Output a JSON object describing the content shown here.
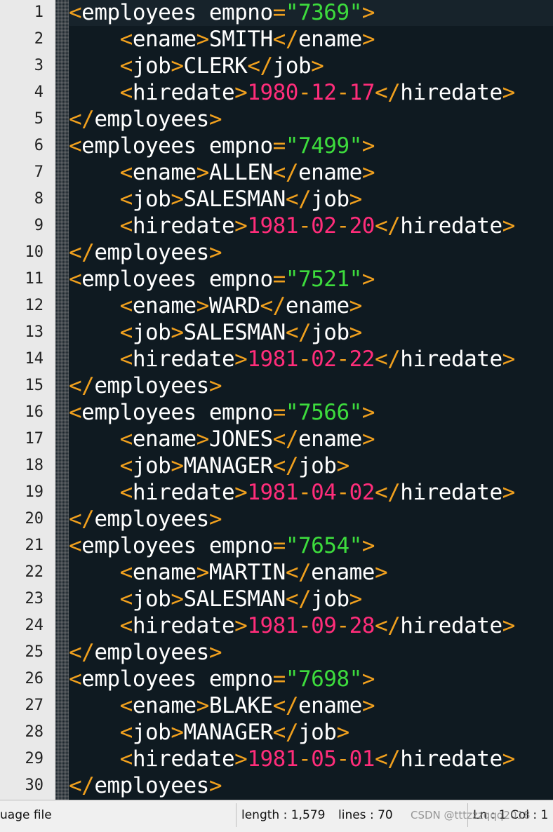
{
  "editor": {
    "current_line": 1,
    "colors": {
      "background": "#0f1a21",
      "bracket": "#f0a01e",
      "tag": "#ffffff",
      "attr_value": "#3ddc3d",
      "date": "#ff2d7a",
      "gutter": "#e9e9e9"
    },
    "lines": [
      {
        "num": "1",
        "tokens": [
          {
            "t": "<",
            "c": "bracket"
          },
          {
            "t": "employees",
            "c": "tag"
          },
          {
            "t": " empno",
            "c": "attr"
          },
          {
            "t": "=",
            "c": "eq"
          },
          {
            "t": "\"7369\"",
            "c": "str"
          },
          {
            "t": ">",
            "c": "bracket"
          }
        ]
      },
      {
        "num": "2",
        "tokens": [
          {
            "t": "    ",
            "c": "text"
          },
          {
            "t": "<",
            "c": "bracket"
          },
          {
            "t": "ename",
            "c": "tag"
          },
          {
            "t": ">",
            "c": "bracket"
          },
          {
            "t": "SMITH",
            "c": "text"
          },
          {
            "t": "</",
            "c": "bracket"
          },
          {
            "t": "ename",
            "c": "tag"
          },
          {
            "t": ">",
            "c": "bracket"
          }
        ]
      },
      {
        "num": "3",
        "tokens": [
          {
            "t": "    ",
            "c": "text"
          },
          {
            "t": "<",
            "c": "bracket"
          },
          {
            "t": "job",
            "c": "tag"
          },
          {
            "t": ">",
            "c": "bracket"
          },
          {
            "t": "CLERK",
            "c": "text"
          },
          {
            "t": "</",
            "c": "bracket"
          },
          {
            "t": "job",
            "c": "tag"
          },
          {
            "t": ">",
            "c": "bracket"
          }
        ]
      },
      {
        "num": "4",
        "tokens": [
          {
            "t": "    ",
            "c": "text"
          },
          {
            "t": "<",
            "c": "bracket"
          },
          {
            "t": "hiredate",
            "c": "tag"
          },
          {
            "t": ">",
            "c": "bracket"
          },
          {
            "t": "1980",
            "c": "num"
          },
          {
            "t": "-",
            "c": "bracket"
          },
          {
            "t": "12",
            "c": "num"
          },
          {
            "t": "-",
            "c": "bracket"
          },
          {
            "t": "17",
            "c": "num"
          },
          {
            "t": "</",
            "c": "bracket"
          },
          {
            "t": "hiredate",
            "c": "tag"
          },
          {
            "t": ">",
            "c": "bracket"
          }
        ]
      },
      {
        "num": "5",
        "tokens": [
          {
            "t": "</",
            "c": "bracket"
          },
          {
            "t": "employees",
            "c": "tag"
          },
          {
            "t": ">",
            "c": "bracket"
          }
        ]
      },
      {
        "num": "6",
        "tokens": [
          {
            "t": "<",
            "c": "bracket"
          },
          {
            "t": "employees",
            "c": "tag"
          },
          {
            "t": " empno",
            "c": "attr"
          },
          {
            "t": "=",
            "c": "eq"
          },
          {
            "t": "\"7499\"",
            "c": "str"
          },
          {
            "t": ">",
            "c": "bracket"
          }
        ]
      },
      {
        "num": "7",
        "tokens": [
          {
            "t": "    ",
            "c": "text"
          },
          {
            "t": "<",
            "c": "bracket"
          },
          {
            "t": "ename",
            "c": "tag"
          },
          {
            "t": ">",
            "c": "bracket"
          },
          {
            "t": "ALLEN",
            "c": "text"
          },
          {
            "t": "</",
            "c": "bracket"
          },
          {
            "t": "ename",
            "c": "tag"
          },
          {
            "t": ">",
            "c": "bracket"
          }
        ]
      },
      {
        "num": "8",
        "tokens": [
          {
            "t": "    ",
            "c": "text"
          },
          {
            "t": "<",
            "c": "bracket"
          },
          {
            "t": "job",
            "c": "tag"
          },
          {
            "t": ">",
            "c": "bracket"
          },
          {
            "t": "SALESMAN",
            "c": "text"
          },
          {
            "t": "</",
            "c": "bracket"
          },
          {
            "t": "job",
            "c": "tag"
          },
          {
            "t": ">",
            "c": "bracket"
          }
        ]
      },
      {
        "num": "9",
        "tokens": [
          {
            "t": "    ",
            "c": "text"
          },
          {
            "t": "<",
            "c": "bracket"
          },
          {
            "t": "hiredate",
            "c": "tag"
          },
          {
            "t": ">",
            "c": "bracket"
          },
          {
            "t": "1981",
            "c": "num"
          },
          {
            "t": "-",
            "c": "bracket"
          },
          {
            "t": "02",
            "c": "num"
          },
          {
            "t": "-",
            "c": "bracket"
          },
          {
            "t": "20",
            "c": "num"
          },
          {
            "t": "</",
            "c": "bracket"
          },
          {
            "t": "hiredate",
            "c": "tag"
          },
          {
            "t": ">",
            "c": "bracket"
          }
        ]
      },
      {
        "num": "10",
        "tokens": [
          {
            "t": "</",
            "c": "bracket"
          },
          {
            "t": "employees",
            "c": "tag"
          },
          {
            "t": ">",
            "c": "bracket"
          }
        ]
      },
      {
        "num": "11",
        "tokens": [
          {
            "t": "<",
            "c": "bracket"
          },
          {
            "t": "employees",
            "c": "tag"
          },
          {
            "t": " empno",
            "c": "attr"
          },
          {
            "t": "=",
            "c": "eq"
          },
          {
            "t": "\"7521\"",
            "c": "str"
          },
          {
            "t": ">",
            "c": "bracket"
          }
        ]
      },
      {
        "num": "12",
        "tokens": [
          {
            "t": "    ",
            "c": "text"
          },
          {
            "t": "<",
            "c": "bracket"
          },
          {
            "t": "ename",
            "c": "tag"
          },
          {
            "t": ">",
            "c": "bracket"
          },
          {
            "t": "WARD",
            "c": "text"
          },
          {
            "t": "</",
            "c": "bracket"
          },
          {
            "t": "ename",
            "c": "tag"
          },
          {
            "t": ">",
            "c": "bracket"
          }
        ]
      },
      {
        "num": "13",
        "tokens": [
          {
            "t": "    ",
            "c": "text"
          },
          {
            "t": "<",
            "c": "bracket"
          },
          {
            "t": "job",
            "c": "tag"
          },
          {
            "t": ">",
            "c": "bracket"
          },
          {
            "t": "SALESMAN",
            "c": "text"
          },
          {
            "t": "</",
            "c": "bracket"
          },
          {
            "t": "job",
            "c": "tag"
          },
          {
            "t": ">",
            "c": "bracket"
          }
        ]
      },
      {
        "num": "14",
        "tokens": [
          {
            "t": "    ",
            "c": "text"
          },
          {
            "t": "<",
            "c": "bracket"
          },
          {
            "t": "hiredate",
            "c": "tag"
          },
          {
            "t": ">",
            "c": "bracket"
          },
          {
            "t": "1981",
            "c": "num"
          },
          {
            "t": "-",
            "c": "bracket"
          },
          {
            "t": "02",
            "c": "num"
          },
          {
            "t": "-",
            "c": "bracket"
          },
          {
            "t": "22",
            "c": "num"
          },
          {
            "t": "</",
            "c": "bracket"
          },
          {
            "t": "hiredate",
            "c": "tag"
          },
          {
            "t": ">",
            "c": "bracket"
          }
        ]
      },
      {
        "num": "15",
        "tokens": [
          {
            "t": "</",
            "c": "bracket"
          },
          {
            "t": "employees",
            "c": "tag"
          },
          {
            "t": ">",
            "c": "bracket"
          }
        ]
      },
      {
        "num": "16",
        "tokens": [
          {
            "t": "<",
            "c": "bracket"
          },
          {
            "t": "employees",
            "c": "tag"
          },
          {
            "t": " empno",
            "c": "attr"
          },
          {
            "t": "=",
            "c": "eq"
          },
          {
            "t": "\"7566\"",
            "c": "str"
          },
          {
            "t": ">",
            "c": "bracket"
          }
        ]
      },
      {
        "num": "17",
        "tokens": [
          {
            "t": "    ",
            "c": "text"
          },
          {
            "t": "<",
            "c": "bracket"
          },
          {
            "t": "ename",
            "c": "tag"
          },
          {
            "t": ">",
            "c": "bracket"
          },
          {
            "t": "JONES",
            "c": "text"
          },
          {
            "t": "</",
            "c": "bracket"
          },
          {
            "t": "ename",
            "c": "tag"
          },
          {
            "t": ">",
            "c": "bracket"
          }
        ]
      },
      {
        "num": "18",
        "tokens": [
          {
            "t": "    ",
            "c": "text"
          },
          {
            "t": "<",
            "c": "bracket"
          },
          {
            "t": "job",
            "c": "tag"
          },
          {
            "t": ">",
            "c": "bracket"
          },
          {
            "t": "MANAGER",
            "c": "text"
          },
          {
            "t": "</",
            "c": "bracket"
          },
          {
            "t": "job",
            "c": "tag"
          },
          {
            "t": ">",
            "c": "bracket"
          }
        ]
      },
      {
        "num": "19",
        "tokens": [
          {
            "t": "    ",
            "c": "text"
          },
          {
            "t": "<",
            "c": "bracket"
          },
          {
            "t": "hiredate",
            "c": "tag"
          },
          {
            "t": ">",
            "c": "bracket"
          },
          {
            "t": "1981",
            "c": "num"
          },
          {
            "t": "-",
            "c": "bracket"
          },
          {
            "t": "04",
            "c": "num"
          },
          {
            "t": "-",
            "c": "bracket"
          },
          {
            "t": "02",
            "c": "num"
          },
          {
            "t": "</",
            "c": "bracket"
          },
          {
            "t": "hiredate",
            "c": "tag"
          },
          {
            "t": ">",
            "c": "bracket"
          }
        ]
      },
      {
        "num": "20",
        "tokens": [
          {
            "t": "</",
            "c": "bracket"
          },
          {
            "t": "employees",
            "c": "tag"
          },
          {
            "t": ">",
            "c": "bracket"
          }
        ]
      },
      {
        "num": "21",
        "tokens": [
          {
            "t": "<",
            "c": "bracket"
          },
          {
            "t": "employees",
            "c": "tag"
          },
          {
            "t": " empno",
            "c": "attr"
          },
          {
            "t": "=",
            "c": "eq"
          },
          {
            "t": "\"7654\"",
            "c": "str"
          },
          {
            "t": ">",
            "c": "bracket"
          }
        ]
      },
      {
        "num": "22",
        "tokens": [
          {
            "t": "    ",
            "c": "text"
          },
          {
            "t": "<",
            "c": "bracket"
          },
          {
            "t": "ename",
            "c": "tag"
          },
          {
            "t": ">",
            "c": "bracket"
          },
          {
            "t": "MARTIN",
            "c": "text"
          },
          {
            "t": "</",
            "c": "bracket"
          },
          {
            "t": "ename",
            "c": "tag"
          },
          {
            "t": ">",
            "c": "bracket"
          }
        ]
      },
      {
        "num": "23",
        "tokens": [
          {
            "t": "    ",
            "c": "text"
          },
          {
            "t": "<",
            "c": "bracket"
          },
          {
            "t": "job",
            "c": "tag"
          },
          {
            "t": ">",
            "c": "bracket"
          },
          {
            "t": "SALESMAN",
            "c": "text"
          },
          {
            "t": "</",
            "c": "bracket"
          },
          {
            "t": "job",
            "c": "tag"
          },
          {
            "t": ">",
            "c": "bracket"
          }
        ]
      },
      {
        "num": "24",
        "tokens": [
          {
            "t": "    ",
            "c": "text"
          },
          {
            "t": "<",
            "c": "bracket"
          },
          {
            "t": "hiredate",
            "c": "tag"
          },
          {
            "t": ">",
            "c": "bracket"
          },
          {
            "t": "1981",
            "c": "num"
          },
          {
            "t": "-",
            "c": "bracket"
          },
          {
            "t": "09",
            "c": "num"
          },
          {
            "t": "-",
            "c": "bracket"
          },
          {
            "t": "28",
            "c": "num"
          },
          {
            "t": "</",
            "c": "bracket"
          },
          {
            "t": "hiredate",
            "c": "tag"
          },
          {
            "t": ">",
            "c": "bracket"
          }
        ]
      },
      {
        "num": "25",
        "tokens": [
          {
            "t": "</",
            "c": "bracket"
          },
          {
            "t": "employees",
            "c": "tag"
          },
          {
            "t": ">",
            "c": "bracket"
          }
        ]
      },
      {
        "num": "26",
        "tokens": [
          {
            "t": "<",
            "c": "bracket"
          },
          {
            "t": "employees",
            "c": "tag"
          },
          {
            "t": " empno",
            "c": "attr"
          },
          {
            "t": "=",
            "c": "eq"
          },
          {
            "t": "\"7698\"",
            "c": "str"
          },
          {
            "t": ">",
            "c": "bracket"
          }
        ]
      },
      {
        "num": "27",
        "tokens": [
          {
            "t": "    ",
            "c": "text"
          },
          {
            "t": "<",
            "c": "bracket"
          },
          {
            "t": "ename",
            "c": "tag"
          },
          {
            "t": ">",
            "c": "bracket"
          },
          {
            "t": "BLAKE",
            "c": "text"
          },
          {
            "t": "</",
            "c": "bracket"
          },
          {
            "t": "ename",
            "c": "tag"
          },
          {
            "t": ">",
            "c": "bracket"
          }
        ]
      },
      {
        "num": "28",
        "tokens": [
          {
            "t": "    ",
            "c": "text"
          },
          {
            "t": "<",
            "c": "bracket"
          },
          {
            "t": "job",
            "c": "tag"
          },
          {
            "t": ">",
            "c": "bracket"
          },
          {
            "t": "MANAGER",
            "c": "text"
          },
          {
            "t": "</",
            "c": "bracket"
          },
          {
            "t": "job",
            "c": "tag"
          },
          {
            "t": ">",
            "c": "bracket"
          }
        ]
      },
      {
        "num": "29",
        "tokens": [
          {
            "t": "    ",
            "c": "text"
          },
          {
            "t": "<",
            "c": "bracket"
          },
          {
            "t": "hiredate",
            "c": "tag"
          },
          {
            "t": ">",
            "c": "bracket"
          },
          {
            "t": "1981",
            "c": "num"
          },
          {
            "t": "-",
            "c": "bracket"
          },
          {
            "t": "05",
            "c": "num"
          },
          {
            "t": "-",
            "c": "bracket"
          },
          {
            "t": "01",
            "c": "num"
          },
          {
            "t": "</",
            "c": "bracket"
          },
          {
            "t": "hiredate",
            "c": "tag"
          },
          {
            "t": ">",
            "c": "bracket"
          }
        ]
      },
      {
        "num": "30",
        "tokens": [
          {
            "t": "</",
            "c": "bracket"
          },
          {
            "t": "employees",
            "c": "tag"
          },
          {
            "t": ">",
            "c": "bracket"
          }
        ]
      }
    ]
  },
  "statusbar": {
    "file_type": "uage file",
    "length": "length : 1,579",
    "lines": "lines : 70",
    "position": "Ln : 1    Col : 1",
    "watermark": "CSDN @tttzzzqqq2018"
  }
}
